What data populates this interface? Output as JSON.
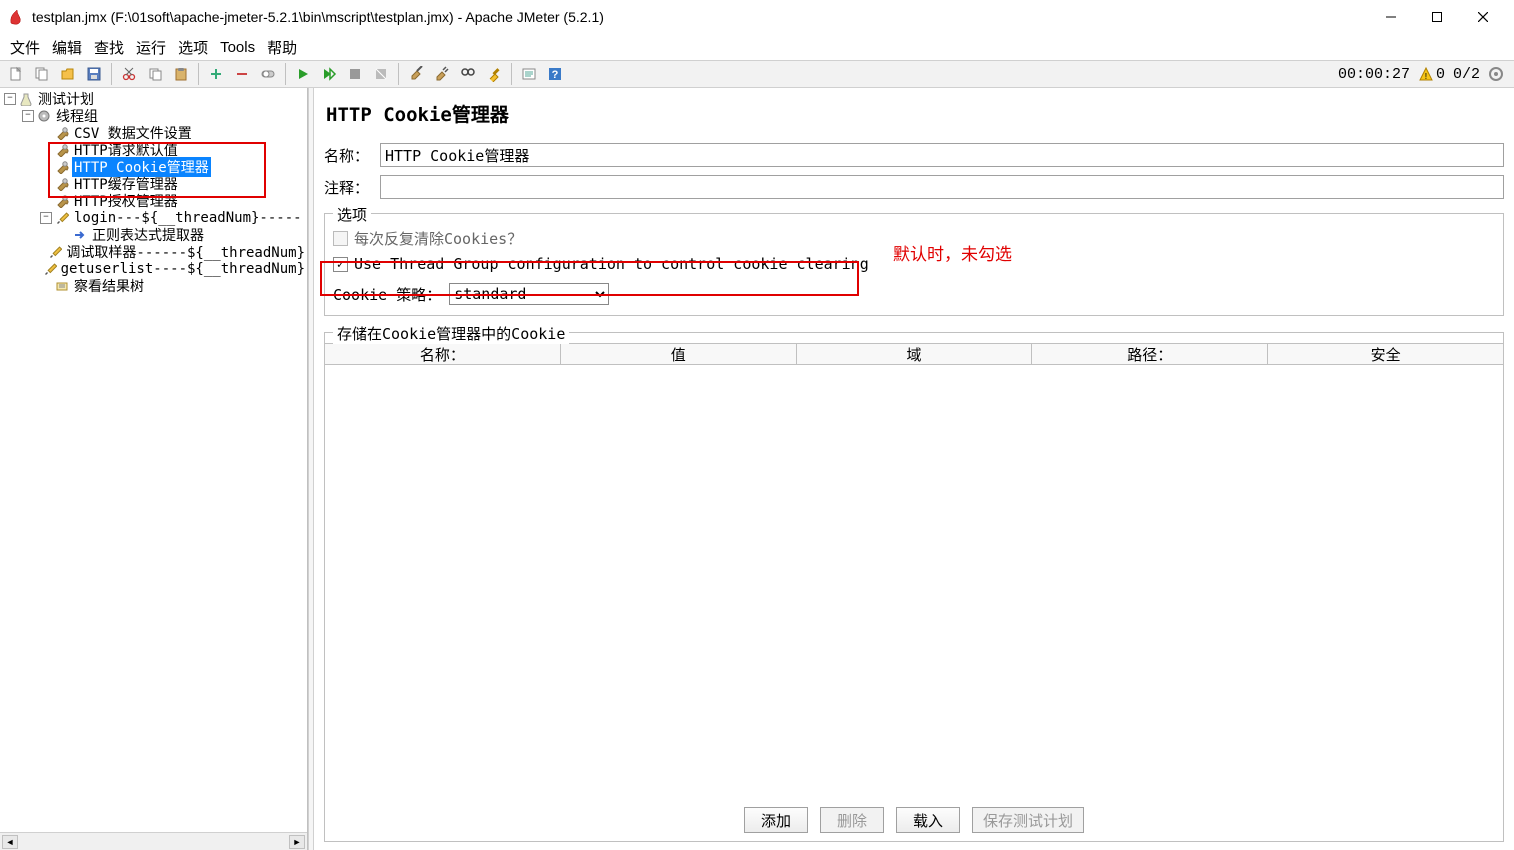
{
  "window": {
    "title": "testplan.jmx (F:\\01soft\\apache-jmeter-5.2.1\\bin\\mscript\\testplan.jmx) - Apache JMeter (5.2.1)"
  },
  "menus": [
    "文件",
    "编辑",
    "查找",
    "运行",
    "选项",
    "Tools",
    "帮助"
  ],
  "status": {
    "time": "00:00:27",
    "warn_count": "0",
    "threads": "0/2"
  },
  "tree": {
    "items": [
      {
        "indent": 0,
        "toggle": "−",
        "icon": "flask",
        "label": "测试计划"
      },
      {
        "indent": 1,
        "toggle": "−",
        "icon": "gear",
        "label": "线程组"
      },
      {
        "indent": 2,
        "toggle": "",
        "icon": "wrench",
        "label": "CSV 数据文件设置"
      },
      {
        "indent": 2,
        "toggle": "",
        "icon": "wrench",
        "label": "HTTP请求默认值"
      },
      {
        "indent": 2,
        "toggle": "",
        "icon": "wrench",
        "label": "HTTP Cookie管理器",
        "selected": true
      },
      {
        "indent": 2,
        "toggle": "",
        "icon": "wrench",
        "label": "HTTP缓存管理器"
      },
      {
        "indent": 2,
        "toggle": "",
        "icon": "wrench",
        "label": "HTTP授权管理器"
      },
      {
        "indent": 2,
        "toggle": "−",
        "icon": "pencil",
        "label": "login---${__threadNum}-----"
      },
      {
        "indent": 3,
        "toggle": "",
        "icon": "arrow",
        "label": "正则表达式提取器"
      },
      {
        "indent": 3,
        "toggle": "",
        "icon": "pencil",
        "label": "调试取样器------${__threadNum}"
      },
      {
        "indent": 2,
        "toggle": "",
        "icon": "pencil",
        "label": "getuserlist----${__threadNum}"
      },
      {
        "indent": 2,
        "toggle": "",
        "icon": "eye",
        "label": "察看结果树"
      }
    ]
  },
  "panel": {
    "title": "HTTP Cookie管理器",
    "name_label": "名称：",
    "name_value": "HTTP Cookie管理器",
    "comment_label": "注释：",
    "comment_value": "",
    "options_legend": "选项",
    "clear_each_label": "每次反复清除Cookies？",
    "use_threadgroup_label": "Use Thread Group configuration to control cookie clearing",
    "policy_label": "Cookie 策略：",
    "policy_value": "standard",
    "storage_legend": "存储在Cookie管理器中的Cookie",
    "columns": [
      "名称：",
      "值",
      "域",
      "路径：",
      "安全"
    ],
    "buttons": {
      "add": "添加",
      "delete": "删除",
      "load": "载入",
      "save": "保存测试计划"
    }
  },
  "annotation": "默认时，未勾选"
}
